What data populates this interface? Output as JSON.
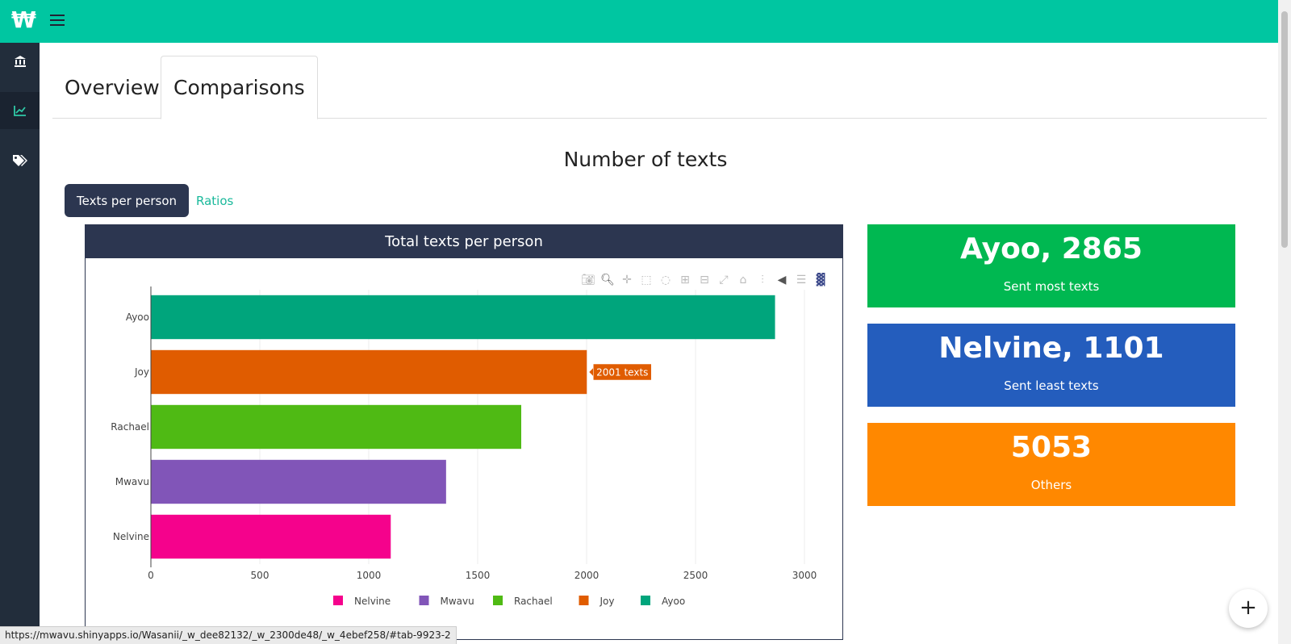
{
  "app": {
    "logo_text": "₩"
  },
  "tabs": [
    {
      "label": "Overview",
      "active": false
    },
    {
      "label": "Comparisons",
      "active": true
    }
  ],
  "section": {
    "title": "Number of texts"
  },
  "subtabs": [
    {
      "label": "Texts per person",
      "active": true
    },
    {
      "label": "Ratios",
      "active": false
    }
  ],
  "chart_panel": {
    "header": "Total texts per person"
  },
  "chart_data": {
    "type": "bar",
    "orientation": "horizontal",
    "categories": [
      "Nelvine",
      "Mwavu",
      "Rachael",
      "Joy",
      "Ayoo"
    ],
    "values": [
      1101,
      1355,
      1700,
      2001,
      2865
    ],
    "colors": [
      "#f5028c",
      "#8155b8",
      "#4fba14",
      "#e05c00",
      "#00a57c"
    ],
    "xlim": [
      0,
      3000
    ],
    "xticks": [
      0,
      500,
      1000,
      1500,
      2000,
      2500,
      3000
    ],
    "grid": true,
    "legend": [
      "Nelvine",
      "Mwavu",
      "Rachael",
      "Joy",
      "Ayoo"
    ],
    "legend_placement": "bottom",
    "hover": {
      "category": "Joy",
      "label": "2001 texts"
    }
  },
  "stats": [
    {
      "value": "Ayoo, 2865",
      "label": "Sent most texts",
      "color": "#00b851"
    },
    {
      "value": "Nelvine, 1101",
      "label": "Sent least texts",
      "color": "#245dbd"
    },
    {
      "value": "5053",
      "label": "Others",
      "color": "#ff8800"
    }
  ],
  "status_url": "https://mwavu.shinyapps.io/Wasanii/_w_dee82132/_w_2300de48/_w_4ebef258/#tab-9923-2",
  "fab_label": "+",
  "icons": {
    "menu": "hamburger-icon",
    "sidebar": [
      "bank-icon",
      "chart-line-icon",
      "tags-icon"
    ],
    "modebar": [
      "camera-icon",
      "zoom-icon",
      "pan-icon",
      "box-select-icon",
      "lasso-icon",
      "zoom-in-icon",
      "zoom-out-icon",
      "autoscale-icon",
      "reset-axes-icon",
      "spike-lines-icon",
      "hover-closest-icon",
      "hover-compare-icon",
      "plotly-logo-icon"
    ]
  }
}
